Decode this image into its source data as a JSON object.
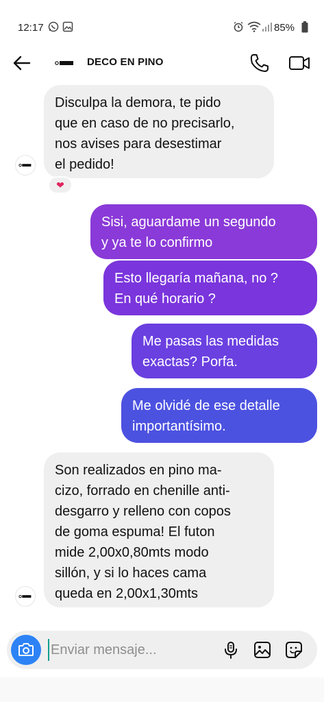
{
  "status_bar": {
    "time": "12:17",
    "battery": "85%",
    "icons": [
      "whatsapp-icon",
      "image-icon",
      "alarm-icon",
      "wifi-icon",
      "signal-icon",
      "battery-icon"
    ]
  },
  "header": {
    "contact_name": "DECO EN PINO",
    "icons": [
      "back-arrow-icon",
      "phone-icon",
      "video-camera-icon"
    ]
  },
  "messages": [
    {
      "sender": "contact",
      "text": "Disculpa la demora, te pido\nque en caso de no precisarlo,\nnos avises para desestimar\nel pedido!",
      "reaction": "❤"
    },
    {
      "sender": "me",
      "text": "Sisi, aguardame un segundo\ny ya te lo confirmo"
    },
    {
      "sender": "me",
      "text": "Esto llegaría mañana, no ?\nEn qué horario ?"
    },
    {
      "sender": "me",
      "text": "Me pasas las medidas\nexactas? Porfa."
    },
    {
      "sender": "me",
      "text": "Me olvidé de ese detalle\nimportantísimo."
    },
    {
      "sender": "contact",
      "text": "Son realizados en pino ma-\ncizo, forrado en chenille anti-\ndesgarro y relleno con copos\nde goma espuma! El futon\nmide 2,00x0,80mts modo\nsillón, y si lo haces cama\nqueda en 2,00x1,30mts"
    }
  ],
  "colors": {
    "outgoing_1": "#8a3ad8",
    "outgoing_2": "#7a35dc",
    "outgoing_3": "#6a40e0",
    "outgoing_4": "#4c52e0",
    "incoming_bg": "#efefef",
    "camera_button": "#2d83f5"
  },
  "composer": {
    "placeholder": "Enviar mensaje...",
    "icons": [
      "camera-icon",
      "microphone-icon",
      "gallery-icon",
      "sticker-icon"
    ]
  }
}
